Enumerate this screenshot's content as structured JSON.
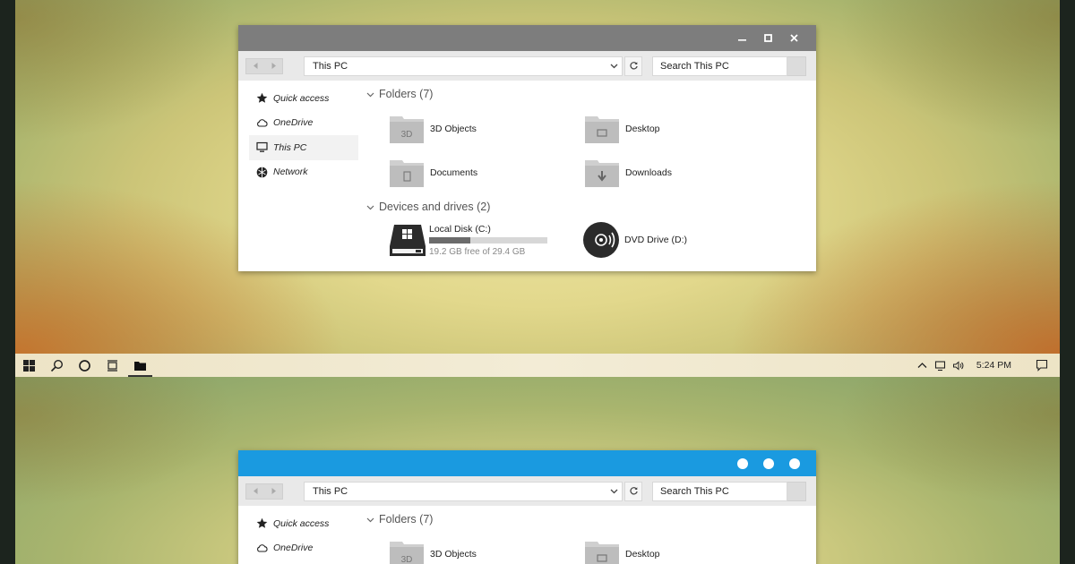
{
  "window": {
    "address": "This PC",
    "search_placeholder": "Search This PC"
  },
  "nav": {
    "items": [
      {
        "label": "Quick access",
        "icon": "star-icon"
      },
      {
        "label": "OneDrive",
        "icon": "cloud-icon"
      },
      {
        "label": "This PC",
        "icon": "monitor-icon",
        "selected": true
      },
      {
        "label": "Network",
        "icon": "network-icon"
      }
    ]
  },
  "folders": {
    "header": "Folders (7)",
    "items": [
      "3D Objects",
      "Desktop",
      "Documents",
      "Downloads"
    ],
    "icon_overlays": [
      "3D"
    ]
  },
  "devices": {
    "header": "Devices and drives (2)",
    "local_disk": {
      "name": "Local Disk (C:)",
      "free_text": "19.2 GB free of 29.4 GB",
      "used_fraction": 0.35
    },
    "dvd": {
      "name": "DVD Drive (D:)"
    }
  },
  "taskbar": {
    "clock": "5:24 PM"
  },
  "colors": {
    "titlebar_gray": "#7d7d7d",
    "titlebar_blue": "#1a9ae0",
    "taskbar_bg": "#f0e8cf"
  }
}
